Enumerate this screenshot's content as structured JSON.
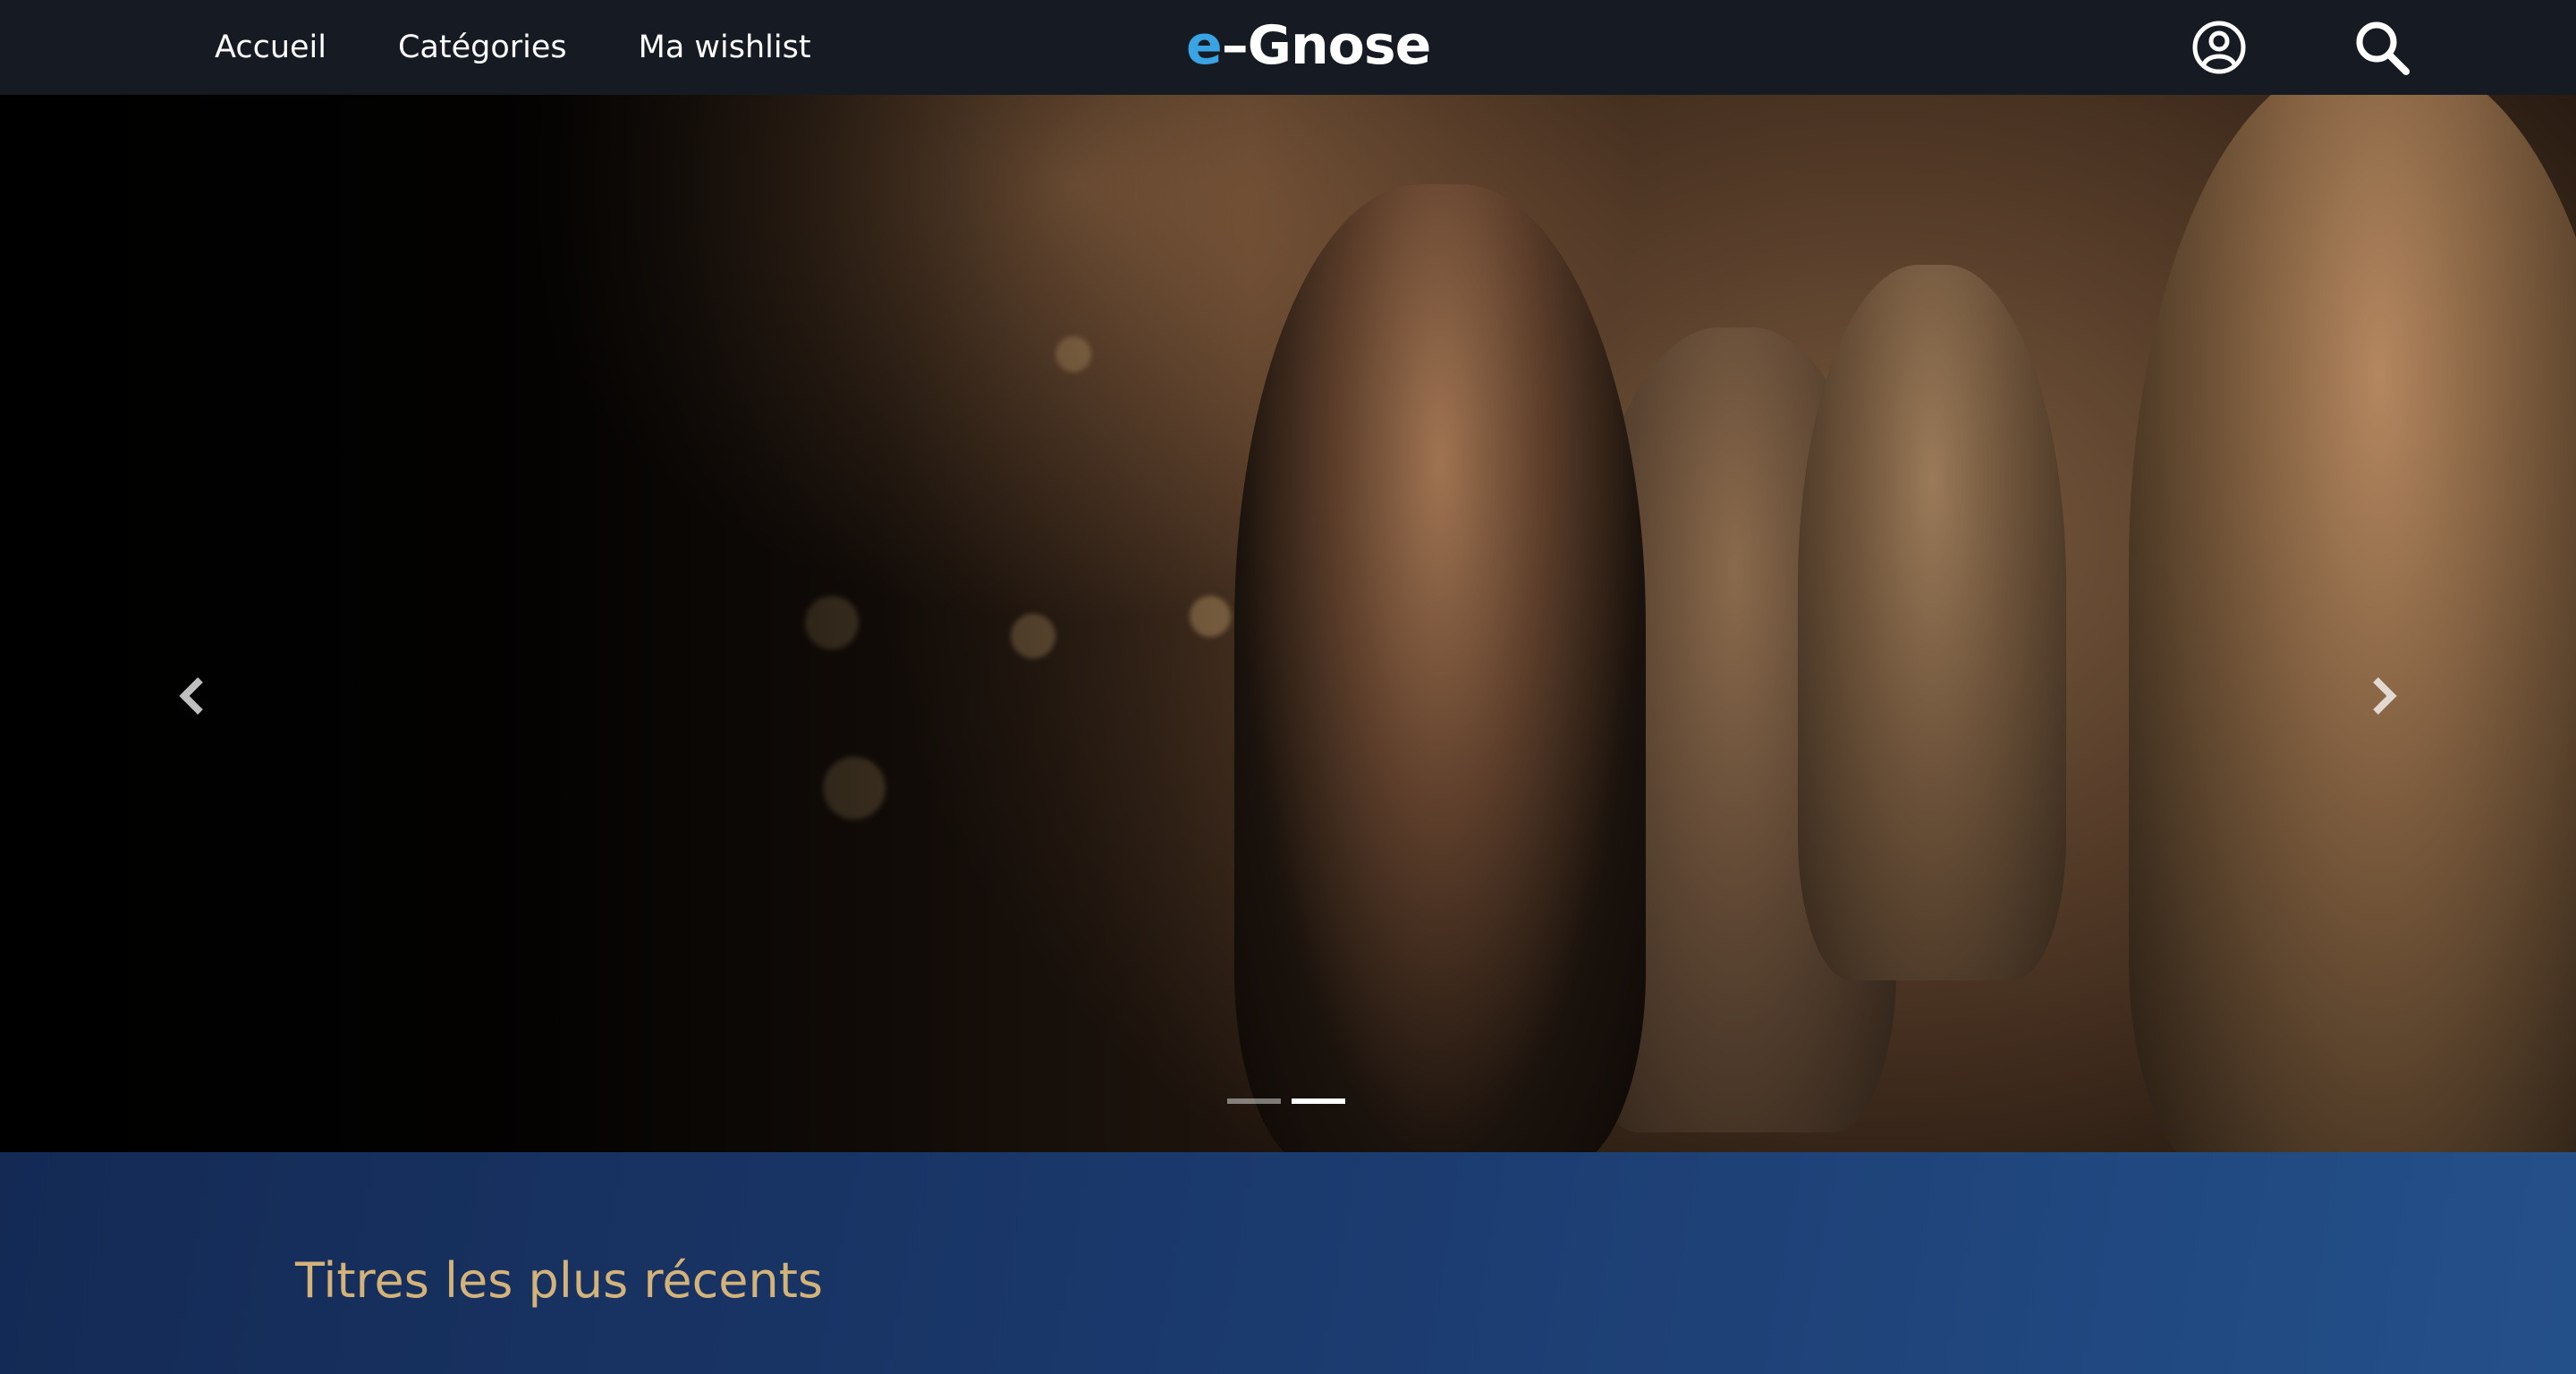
{
  "nav": {
    "links": [
      {
        "label": "Accueil"
      },
      {
        "label": "Catégories"
      },
      {
        "label": "Ma wishlist"
      }
    ],
    "logo": {
      "prefix": "e",
      "rest": "–Gnose"
    },
    "icons": {
      "account": "user-circle-icon",
      "search": "search-icon"
    }
  },
  "hero": {
    "prev_icon": "chevron-left-icon",
    "next_icon": "chevron-right-icon",
    "indicators": [
      {
        "active": false
      },
      {
        "active": true
      }
    ]
  },
  "section": {
    "title": "Titres les plus récents"
  },
  "colors": {
    "navbar": "#161b23",
    "logo_accent": "#3aa3e3",
    "section_bg": "#1b3a6e",
    "section_title": "#d3b37a"
  }
}
